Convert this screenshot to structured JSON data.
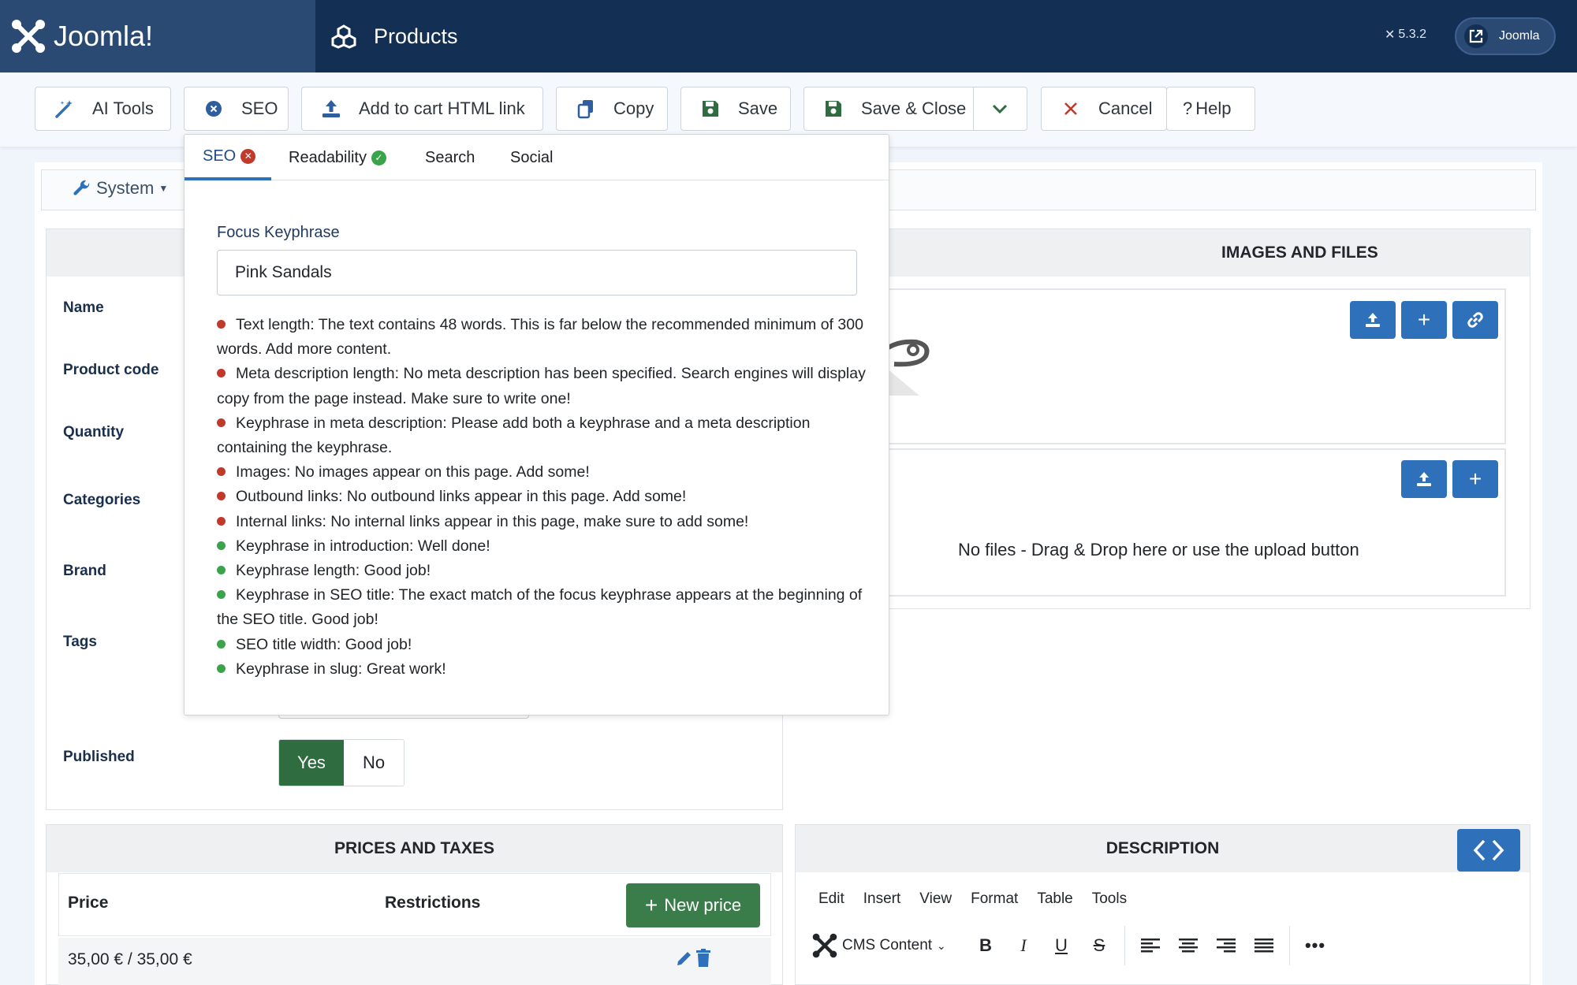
{
  "header": {
    "brand": "Joomla!",
    "title": "Products",
    "version": "5.3.2",
    "user": "Joomla"
  },
  "toolbar": {
    "ai_tools": "AI Tools",
    "seo": "SEO",
    "add_to_cart": "Add to cart HTML link",
    "copy": "Copy",
    "save": "Save",
    "save_close": "Save & Close",
    "cancel": "Cancel",
    "help": "Help"
  },
  "subnav": {
    "system": "System"
  },
  "fields": {
    "name": "Name",
    "product_code": "Product code",
    "quantity": "Quantity",
    "categories": "Categories",
    "brand": "Brand",
    "tags": "Tags",
    "published": "Published",
    "published_yes": "Yes",
    "published_no": "No"
  },
  "images_files": {
    "title": "IMAGES AND FILES",
    "no_files": "No files - Drag & Drop here or use the upload button"
  },
  "prices": {
    "title": "PRICES AND TAXES",
    "col_price": "Price",
    "col_restrictions": "Restrictions",
    "new_price": "New price",
    "row_value": "35,00 € / 35,00 €"
  },
  "description": {
    "title": "DESCRIPTION",
    "menu": [
      "Edit",
      "Insert",
      "View",
      "Format",
      "Table",
      "Tools"
    ],
    "cms_content": "CMS Content"
  },
  "seo_panel": {
    "tabs": [
      "SEO",
      "Readability",
      "Search",
      "Social"
    ],
    "keyphrase_label": "Focus Keyphrase",
    "keyphrase_value": "Pink Sandals",
    "results": [
      {
        "status": "bad",
        "text": "Text length: The text contains 48 words. This is far below the recommended minimum of 300 words. Add more content."
      },
      {
        "status": "bad",
        "text": "Meta description length: No meta description has been specified. Search engines will display copy from the page instead. Make sure to write one!"
      },
      {
        "status": "bad",
        "text": "Keyphrase in meta description: Please add both a keyphrase and a meta description containing the keyphrase."
      },
      {
        "status": "bad",
        "text": "Images: No images appear on this page. Add some!"
      },
      {
        "status": "bad",
        "text": "Outbound links: No outbound links appear in this page. Add some!"
      },
      {
        "status": "bad",
        "text": "Internal links: No internal links appear in this page, make sure to add some!"
      },
      {
        "status": "good",
        "text": "Keyphrase in introduction: Well done!"
      },
      {
        "status": "good",
        "text": "Keyphrase length: Good job!"
      },
      {
        "status": "good",
        "text": "Keyphrase in SEO title: The exact match of the focus keyphrase appears at the beginning of the SEO title. Good job!"
      },
      {
        "status": "good",
        "text": "SEO title width: Good job!"
      },
      {
        "status": "good",
        "text": "Keyphrase in slug: Great work!"
      }
    ]
  },
  "colors": {
    "header_bg": "#132f53",
    "accent": "#2e70b9",
    "bad": "#c0392b",
    "good": "#3aa44a",
    "published": "#2f6d41"
  },
  "icons": {
    "brand": "joomla-logo-icon",
    "title": "cubes-icon",
    "version": "joomla-small-icon",
    "user": "external-link-icon",
    "ai_tools": "magic-wand-icon",
    "seo": "x-circle-icon",
    "add_to_cart": "upload-icon",
    "copy": "copy-icon",
    "save": "floppy-icon",
    "save_close": "floppy-icon",
    "dropdown": "chevron-down-icon",
    "cancel": "close-icon",
    "help": "question-icon",
    "system": "wrench-icon"
  }
}
